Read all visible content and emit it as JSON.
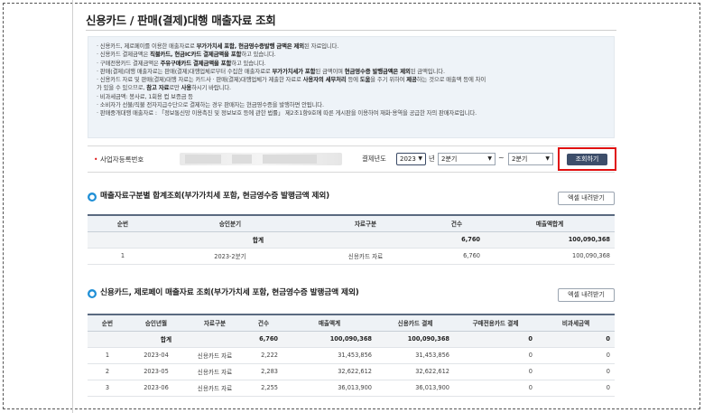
{
  "page": {
    "title": "신용카드 / 판매(결제)대행 매출자료 조회"
  },
  "notice": {
    "lines": [
      [
        "· 신용카드, 제로페이를 이용한 매출자료로 ",
        "부가가치세 포함, 현금영수증발행 금액은 제외",
        "된 자료입니다."
      ],
      [
        "· 신용카드 결제금액은 ",
        "직불카드, 현금IC카드 결제금액을 포함",
        "하고 있습니다."
      ],
      [
        "· 구매전용카드 결제금액은 ",
        "주유구매카드 결제금액을 포함",
        "하고 있습니다."
      ],
      [
        "· 판매(결제)대행 매출자료는 판매(결제)대행업체로부터 수집한 매출자료로 ",
        "부가가치세가 포함",
        "된 금액이며 ",
        "현금영수증 발행금액은 제외",
        "된 금액입니다."
      ],
      [
        "· 신용카드 자료 및 판매(결제)대행 자료는 카드사 · 판매(결제)대행업체가 제출한 자료로 ",
        "사용자의 세무처리",
        " 등에 ",
        "도움",
        "을 주기 위하여 ",
        "제공",
        "하는 것으로 매출액 등에 차이"
      ],
      [
        "  가 있을 수 있으므로, ",
        "참고 자료",
        "로만 ",
        "사용",
        "하시기 바랍니다."
      ],
      [
        "· 비과세금액: 봉사료, 1회용 컵 보증금 등"
      ],
      [
        "· 소비자가 선불/직불 전자지급수단으로 결제하는 경우 판매자는 현금영수증을 발행하면 안됩니다."
      ],
      [
        "· 판매중개대행 매출자료 : 「정보통신망 이용촉진 및 정보보호 등에 관한 법률」 제2조1항9호에 따른 게시판을 이용하여 재화·용역을 공급한 자의 판매자료입니다."
      ]
    ]
  },
  "search": {
    "required_mark": "•",
    "biz_no_label": "사업자등록번호",
    "year_label": "결제년도",
    "year_value": "2023",
    "year_suffix": "년",
    "from_quarter": "2분기",
    "tilde": "~",
    "to_quarter": "2분기",
    "search_button": "조회하기",
    "chevron": "▼"
  },
  "section1": {
    "icon": "●",
    "title": "매출자료구분별 합계조회(부가가치세 포함, 현금영수증 발행금액 제외)",
    "excel_button": "엑셀 내려받기",
    "headers": [
      "순번",
      "승인분기",
      "자료구분",
      "건수",
      "매출액합계"
    ],
    "sum_row": {
      "label": "합계",
      "count": "6,760",
      "total": "100,090,368"
    },
    "rows": [
      {
        "no": "1",
        "quarter": "2023-2분기",
        "type": "신용카드 자료",
        "count": "6,760",
        "total": "100,090,368"
      }
    ]
  },
  "section2": {
    "icon": "●",
    "title": "신용카드, 제로페이 매출자료 조회(부가가치세 포함, 현금영수증 발행금액 제외)",
    "excel_button": "엑셀 내려받기",
    "headers": [
      "순번",
      "승인년월",
      "자료구분",
      "건수",
      "매출액계",
      "신용카드 결제",
      "구매전용카드 결제",
      "비과세금액"
    ],
    "sum_row": {
      "label": "합계",
      "count": "6,760",
      "total": "100,090,368",
      "card": "100,090,368",
      "purchase": "0",
      "taxfree": "0"
    },
    "rows": [
      {
        "no": "1",
        "month": "2023-04",
        "type": "신용카드 자료",
        "count": "2,222",
        "total": "31,453,856",
        "card": "31,453,856",
        "purchase": "0",
        "taxfree": "0"
      },
      {
        "no": "2",
        "month": "2023-05",
        "type": "신용카드 자료",
        "count": "2,283",
        "total": "32,622,612",
        "card": "32,622,612",
        "purchase": "0",
        "taxfree": "0"
      },
      {
        "no": "3",
        "month": "2023-06",
        "type": "신용카드 자료",
        "count": "2,255",
        "total": "36,013,900",
        "card": "36,013,900",
        "purchase": "0",
        "taxfree": "0"
      }
    ]
  }
}
